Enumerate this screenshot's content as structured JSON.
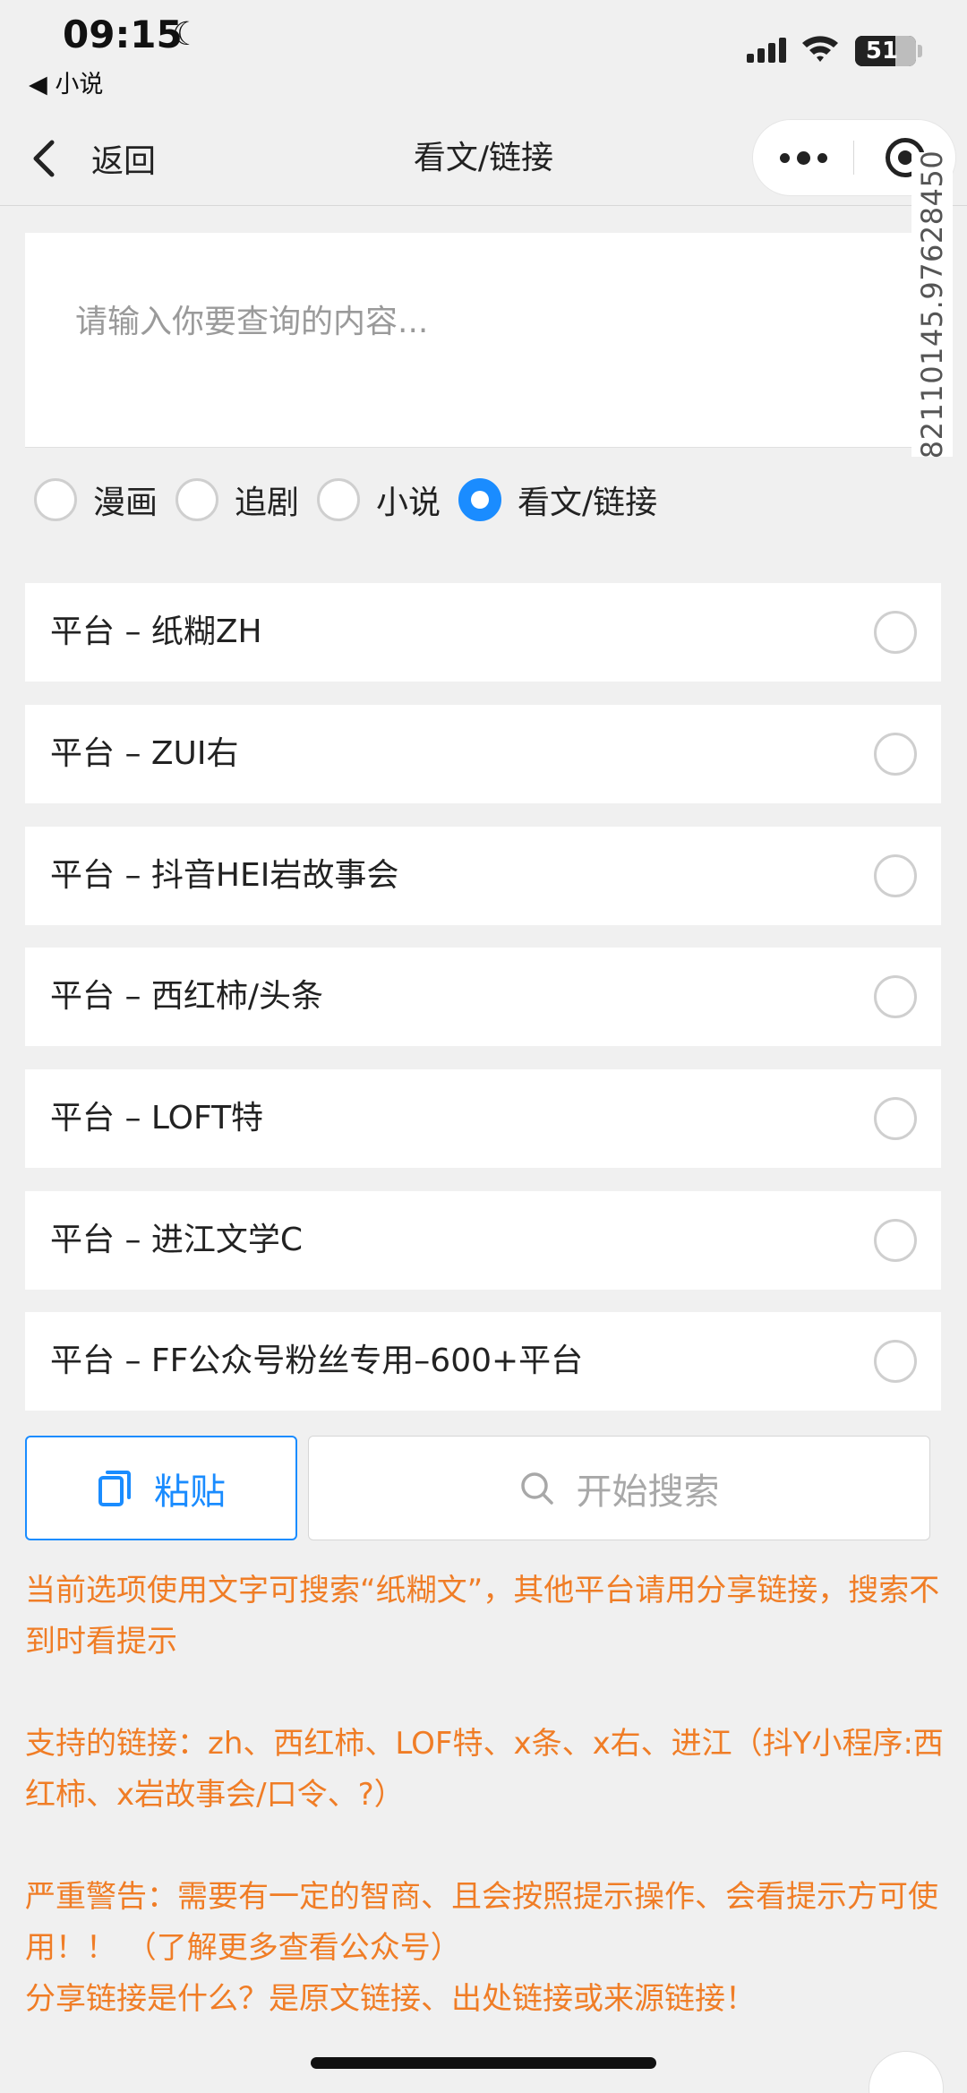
{
  "status_bar": {
    "time": "09:15",
    "back_app": "◀ 小说",
    "battery": "51"
  },
  "nav": {
    "back_label": "返回",
    "title": "看文/链接"
  },
  "watermark": "82110145.97628450",
  "search": {
    "placeholder": "请输入你要查询的内容..."
  },
  "categories": [
    {
      "label": "漫画",
      "selected": false
    },
    {
      "label": "追剧",
      "selected": false
    },
    {
      "label": "小说",
      "selected": false
    },
    {
      "label": "看文/链接",
      "selected": true
    }
  ],
  "platforms": [
    "平台 – 纸糊ZH",
    "平台 – ZUI右",
    "平台 – 抖音HEI岩故事会",
    "平台 – 西红柿/头条",
    "平台 – LOFT特",
    "平台 – 进江文学C",
    "平台 – FF公众号粉丝专用–600+平台"
  ],
  "buttons": {
    "paste": "粘贴",
    "search": "开始搜索"
  },
  "notes": {
    "line1": "当前选项使用文字可搜索“纸糊文”，其他平台请用分享链接，搜索不到时看提示",
    "line2": "支持的链接：zh、西红柿、LOF特、x条、x右、进江（抖Y小程序:西红柿、x岩故事会/口令、?）",
    "line3": "严重警告：需要有一定的智商、且会按照提示操作、会看提示方可使用！！ （了解更多查看公众号）",
    "line4": "分享链接是什么？是原文链接、出处链接或来源链接！"
  },
  "colors": {
    "accent": "#1a8cff",
    "warning_text": "#f07d26",
    "background": "#f0f0f0"
  }
}
